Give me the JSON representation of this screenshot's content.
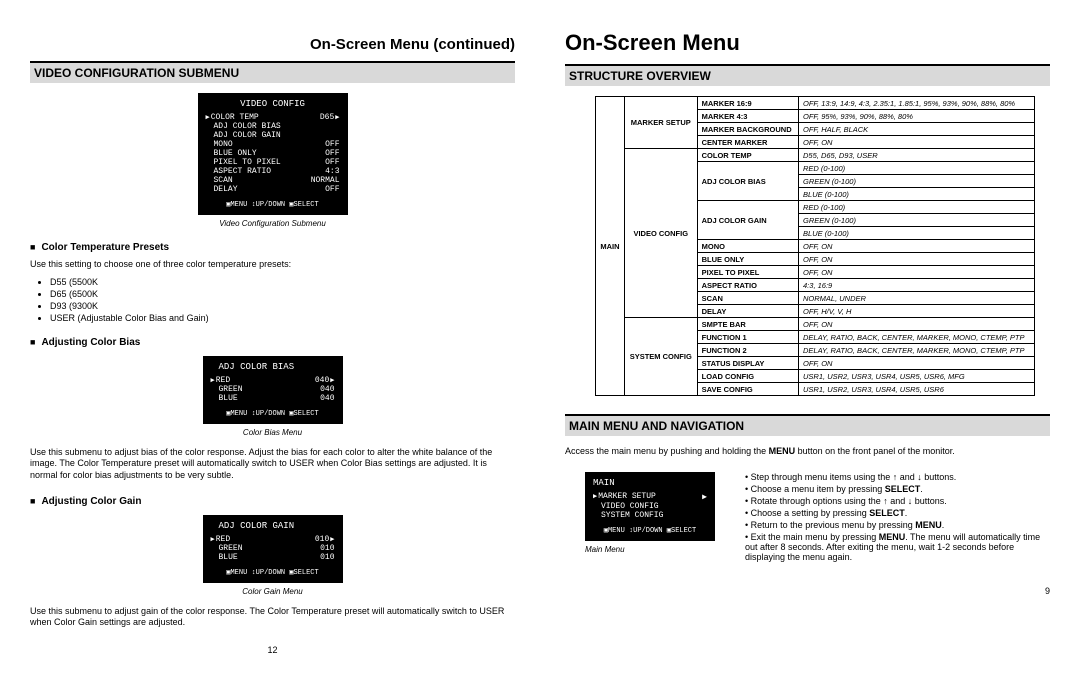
{
  "left": {
    "contTitle": "On-Screen Menu (continued)",
    "section": "VIDEO CONFIGURATION SUBMENU",
    "monitor1": {
      "title": "VIDEO CONFIG",
      "rows": [
        [
          "COLOR TEMP",
          "D65"
        ],
        [
          "ADJ COLOR BIAS",
          ""
        ],
        [
          "ADJ COLOR GAIN",
          ""
        ],
        [
          "MONO",
          "OFF"
        ],
        [
          "BLUE ONLY",
          "OFF"
        ],
        [
          "PIXEL TO PIXEL",
          "OFF"
        ],
        [
          "ASPECT RATIO",
          "4:3"
        ],
        [
          "SCAN",
          "NORMAL"
        ],
        [
          "DELAY",
          "OFF"
        ]
      ],
      "foot": "▣MENU ↕UP/DOWN ▣SELECT",
      "caption": "Video Configuration Submenu"
    },
    "presets": {
      "head": "Color Temperature Presets",
      "desc": "Use this setting to choose one of three color temperature presets:",
      "items": [
        "D55 (5500K",
        "D65 (6500K",
        "D93 (9300K",
        "USER (Adjustable Color Bias and Gain)"
      ]
    },
    "bias": {
      "head": "Adjusting Color Bias",
      "monitor": {
        "title": "ADJ COLOR BIAS",
        "rows": [
          [
            "RED",
            "040"
          ],
          [
            "GREEN",
            "040"
          ],
          [
            "BLUE",
            "040"
          ]
        ],
        "foot": "▣MENU ↕UP/DOWN ▣SELECT",
        "caption": "Color Bias Menu"
      },
      "desc": "Use this submenu to adjust bias of the color response. Adjust the bias for each color to alter the white balance of the image. The Color Temperature preset will automatically switch to USER when Color Bias settings are adjusted. It is normal for color bias adjustments to be very subtle."
    },
    "gain": {
      "head": "Adjusting Color Gain",
      "monitor": {
        "title": "ADJ COLOR GAIN",
        "rows": [
          [
            "RED",
            "010"
          ],
          [
            "GREEN",
            "010"
          ],
          [
            "BLUE",
            "010"
          ]
        ],
        "foot": "▣MENU ↕UP/DOWN ▣SELECT",
        "caption": "Color Gain Menu"
      },
      "desc": "Use this submenu to adjust gain of the color response. The Color Temperature preset will automatically switch to USER when Color Gain settings are adjusted."
    },
    "pageNum": "12"
  },
  "right": {
    "mainTitle": "On-Screen Menu",
    "section1": "STRUCTURE OVERVIEW",
    "table": {
      "main": "MAIN",
      "groups": [
        {
          "name": "MARKER SETUP",
          "rows": [
            [
              "MARKER 16:9",
              "OFF, 13:9, 14:9, 4:3, 2.35:1, 1.85:1, 95%, 93%, 90%, 88%, 80%"
            ],
            [
              "MARKER 4:3",
              "OFF, 95%, 93%, 90%, 88%, 80%"
            ],
            [
              "MARKER BACKGROUND",
              "OFF, HALF, BLACK"
            ],
            [
              "CENTER MARKER",
              "OFF, ON"
            ]
          ]
        },
        {
          "name": "VIDEO CONFIG",
          "rows": [
            [
              "COLOR TEMP",
              "D55, D65, D93, USER"
            ],
            [
              "ADJ COLOR BIAS",
              "RED (0-100)"
            ],
            [
              "",
              "GREEN (0-100)"
            ],
            [
              "",
              "BLUE (0-100)"
            ],
            [
              "ADJ COLOR GAIN",
              "RED (0-100)"
            ],
            [
              "",
              "GREEN (0-100)"
            ],
            [
              "",
              "BLUE (0-100)"
            ],
            [
              "MONO",
              "OFF, ON"
            ],
            [
              "BLUE ONLY",
              "OFF, ON"
            ],
            [
              "PIXEL TO PIXEL",
              "OFF, ON"
            ],
            [
              "ASPECT RATIO",
              "4:3, 16:9"
            ],
            [
              "SCAN",
              "NORMAL, UNDER"
            ],
            [
              "DELAY",
              "OFF, H/V, V, H"
            ]
          ]
        },
        {
          "name": "SYSTEM CONFIG",
          "rows": [
            [
              "SMPTE BAR",
              "OFF, ON"
            ],
            [
              "FUNCTION 1",
              "DELAY, RATIO, BACK, CENTER, MARKER, MONO, CTEMP, PTP"
            ],
            [
              "FUNCTION 2",
              "DELAY, RATIO, BACK, CENTER, MARKER, MONO, CTEMP, PTP"
            ],
            [
              "STATUS DISPLAY",
              "OFF, ON"
            ],
            [
              "LOAD CONFIG",
              "USR1, USR2, USR3, USR4, USR5, USR6, MFG"
            ],
            [
              "SAVE CONFIG",
              "USR1, USR2, USR3, USR4, USR5, USR6"
            ]
          ]
        }
      ]
    },
    "section2": "MAIN MENU AND NAVIGATION",
    "navIntro1": "Access the main menu by pushing and holding the ",
    "navMenuBold": "MENU",
    "navIntro2": " button on the front panel of the monitor.",
    "monitor": {
      "title": "MAIN",
      "rows": [
        [
          "MARKER SETUP",
          ""
        ],
        [
          "VIDEO CONFIG",
          ""
        ],
        [
          "SYSTEM CONFIG",
          ""
        ]
      ],
      "foot": "▣MENU ↕UP/DOWN ▣SELECT",
      "caption": "Main Menu"
    },
    "navItems": [
      "Step through menu items using the ↑ and ↓ buttons.",
      "Choose a menu item by pressing SELECT.",
      "Rotate through options using the ↑ and ↓ buttons.",
      "Choose a setting by pressing SELECT.",
      "Return to the previous menu by pressing MENU.",
      "Exit the main menu by pressing MENU. The menu will automatically time out after 8 seconds. After exiting the menu, wait 1-2 seconds before displaying the menu again."
    ],
    "pageNum": "9"
  }
}
